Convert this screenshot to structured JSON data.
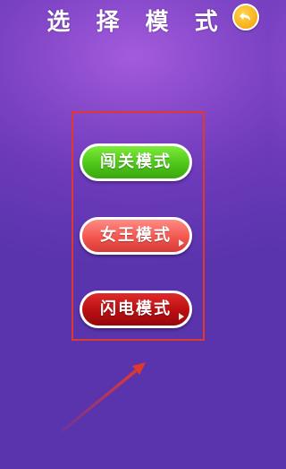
{
  "header": {
    "title": "选 择 模 式",
    "back_icon": "back-arrow-icon"
  },
  "modes": [
    {
      "label": "闯关模式",
      "color": "#4ec61a"
    },
    {
      "label": "女王模式",
      "color": "#f2564f"
    },
    {
      "label": "闪电模式",
      "color": "#b80f12"
    }
  ],
  "annotation": {
    "highlight_color": "#e0382e",
    "arrow": "pointer-arrow-icon"
  }
}
